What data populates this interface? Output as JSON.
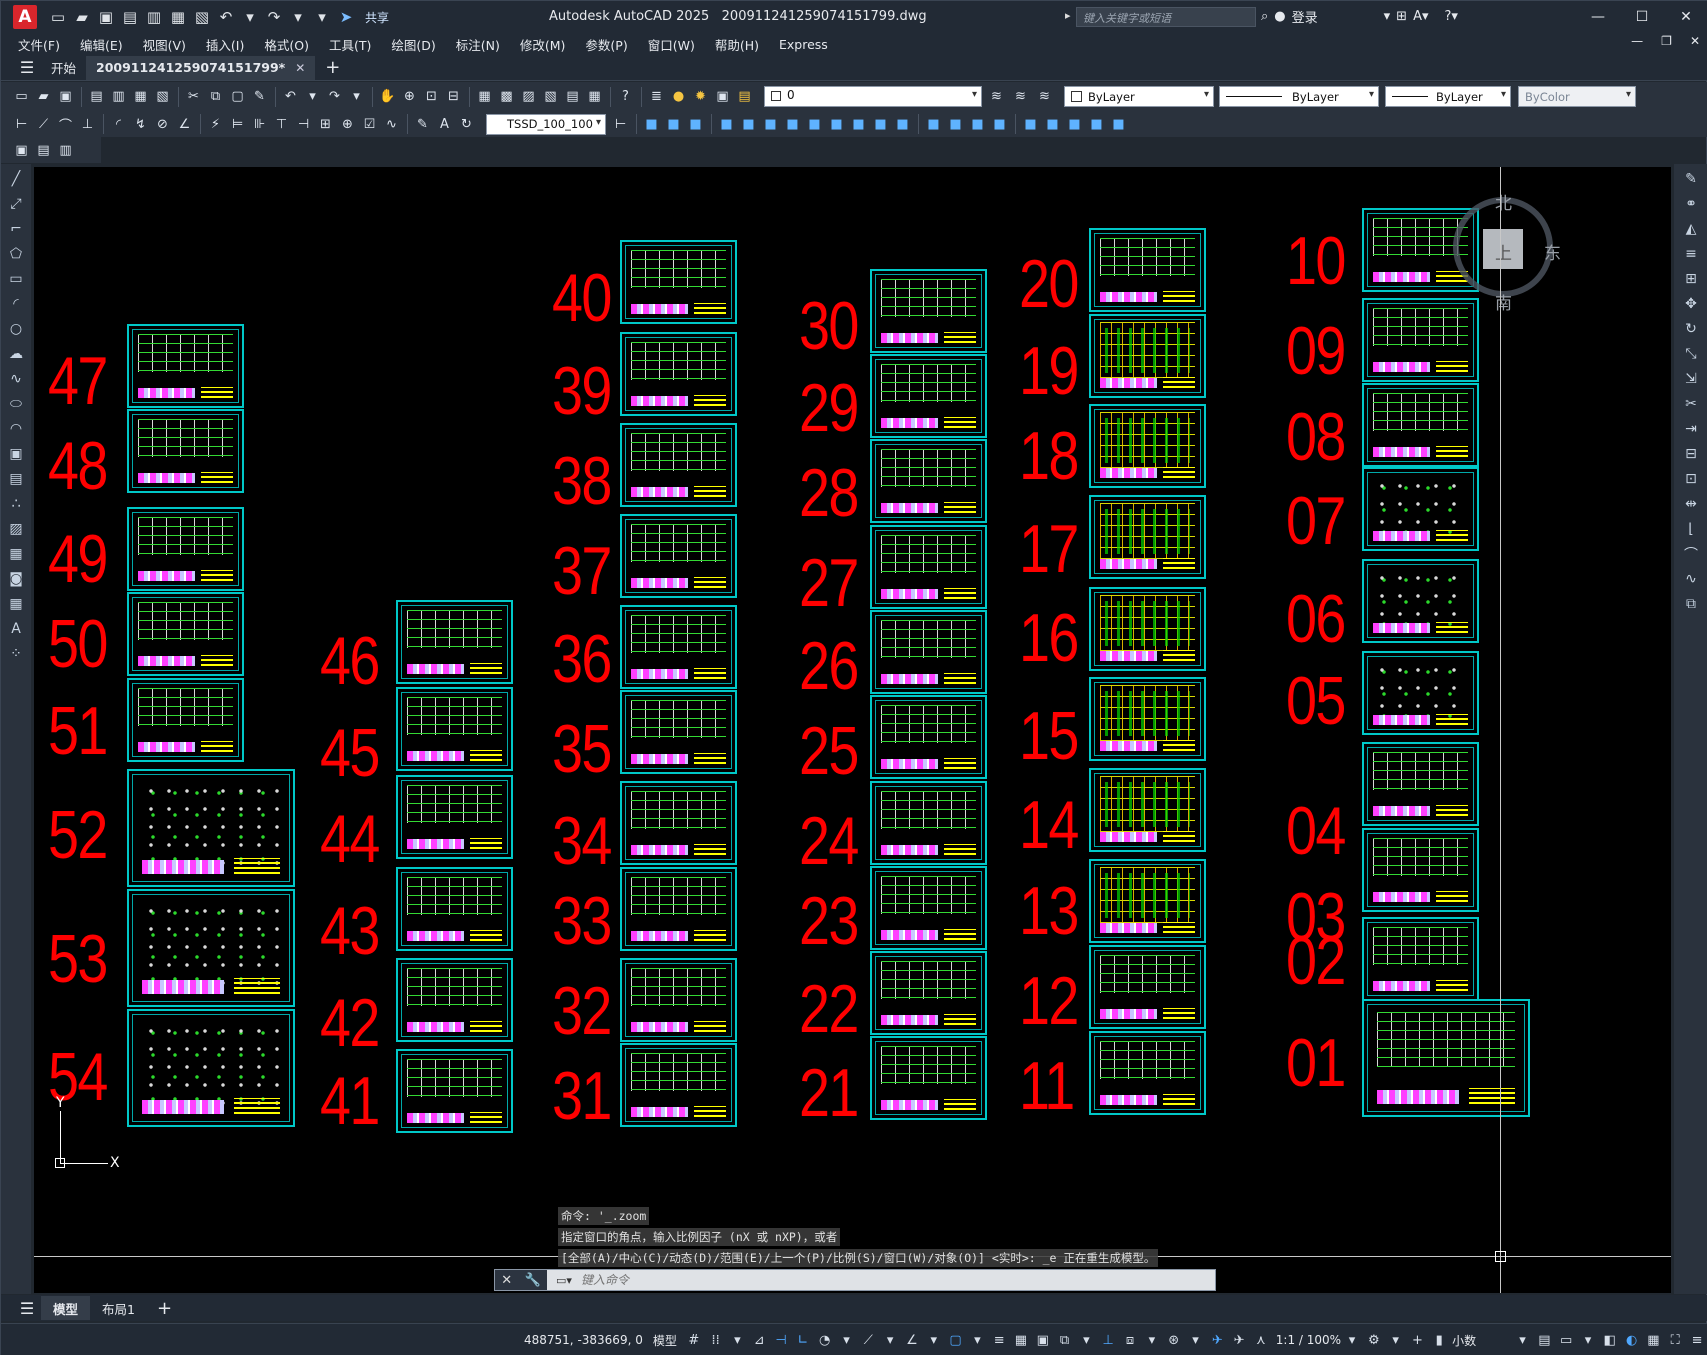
{
  "app": {
    "title": "Autodesk AutoCAD 2025",
    "file": "20091124125907415179​9.dwg",
    "logo": "A",
    "share": "共享",
    "search_placeholder": "键入关键字或短语",
    "login": "登录"
  },
  "menu": [
    "文件(F)",
    "编辑(E)",
    "视图(V)",
    "插入(I)",
    "格式(O)",
    "工具(T)",
    "绘图(D)",
    "标注(N)",
    "修改(M)",
    "参数(P)",
    "窗口(W)",
    "帮助(H)",
    "Express"
  ],
  "tabs": {
    "start": "开始",
    "doc": "200911241259074151799*"
  },
  "properties": {
    "layer": "0",
    "color": "ByLayer",
    "linetype": "ByLayer",
    "lineweight": "ByLayer",
    "plotstyle": "ByColor",
    "dimstyle": "TSSD_100_100"
  },
  "viewcube": {
    "n": "北",
    "e": "东",
    "s": "南",
    "top": "上"
  },
  "ucs": {
    "x": "X",
    "y": "Y"
  },
  "sheet_labels": {
    "c1": [
      "47",
      "48",
      "49",
      "50",
      "51",
      "52",
      "53",
      "54"
    ],
    "c2": [
      "46",
      "45",
      "44",
      "43",
      "42",
      "41"
    ],
    "c3": [
      "40",
      "39",
      "38",
      "37",
      "36",
      "35",
      "34",
      "33",
      "32",
      "31"
    ],
    "c4": [
      "30",
      "29",
      "28",
      "27",
      "26",
      "25",
      "24",
      "23",
      "22",
      "21"
    ],
    "c5": [
      "20",
      "19",
      "18",
      "17",
      "16",
      "15",
      "14",
      "13",
      "12",
      "11"
    ],
    "c6": [
      "10",
      "09",
      "08",
      "07",
      "06",
      "05",
      "04",
      "03",
      "02",
      "01"
    ]
  },
  "command": {
    "history": [
      "命令: '_.zoom",
      "指定窗口的角点，输入比例因子 (nX 或 nXP)，或者",
      "[全部(A)/中心(C)/动态(D)/范围(E)/上一个(P)/比例(S)/窗口(W)/对象(O)] <实时>: _e 正在重生成模型。"
    ],
    "placeholder": "键入命令"
  },
  "layouts": {
    "model": "模型",
    "layout1": "布局1"
  },
  "status": {
    "coords": "488751, -383669, 0",
    "model": "模型",
    "scale": "1:1 / 100%",
    "units": "小数"
  }
}
